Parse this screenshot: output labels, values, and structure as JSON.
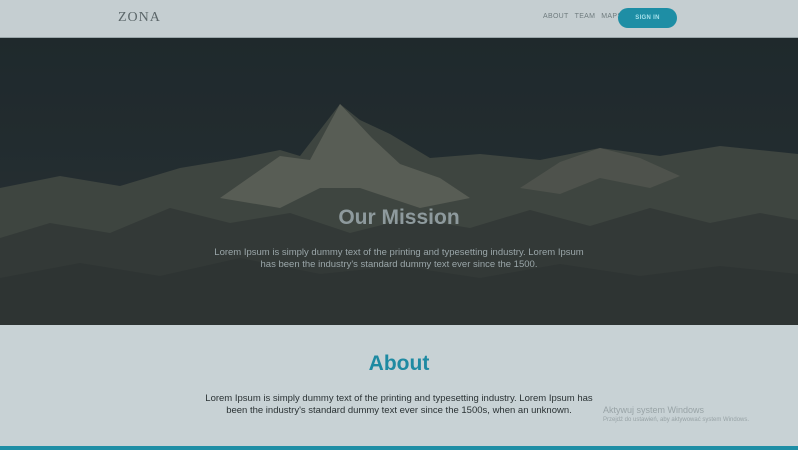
{
  "header": {
    "logo": "ZONA",
    "nav": [
      "ABOUT",
      "TEAM",
      "MAPS"
    ],
    "sign_in_label": "SIGN IN"
  },
  "hero": {
    "title": "Our Mission",
    "text": "Lorem Ipsum is simply dummy text of the printing and typesetting industry. Lorem Ipsum has been the industry's standard dummy text ever since the 1500."
  },
  "about": {
    "title": "About",
    "text": "Lorem Ipsum is simply dummy text of the printing and typesetting industry. Lorem Ipsum has been the industry's standard dummy text ever since the 1500s, when an unknown."
  },
  "watermark": {
    "line1": "Aktywuj system Windows",
    "line2": "Przejdź do ustawień, aby aktywować system Windows."
  },
  "colors": {
    "accent": "#1e8ea5",
    "header_bg": "#c5ced1",
    "hero_bg": "#263033"
  }
}
